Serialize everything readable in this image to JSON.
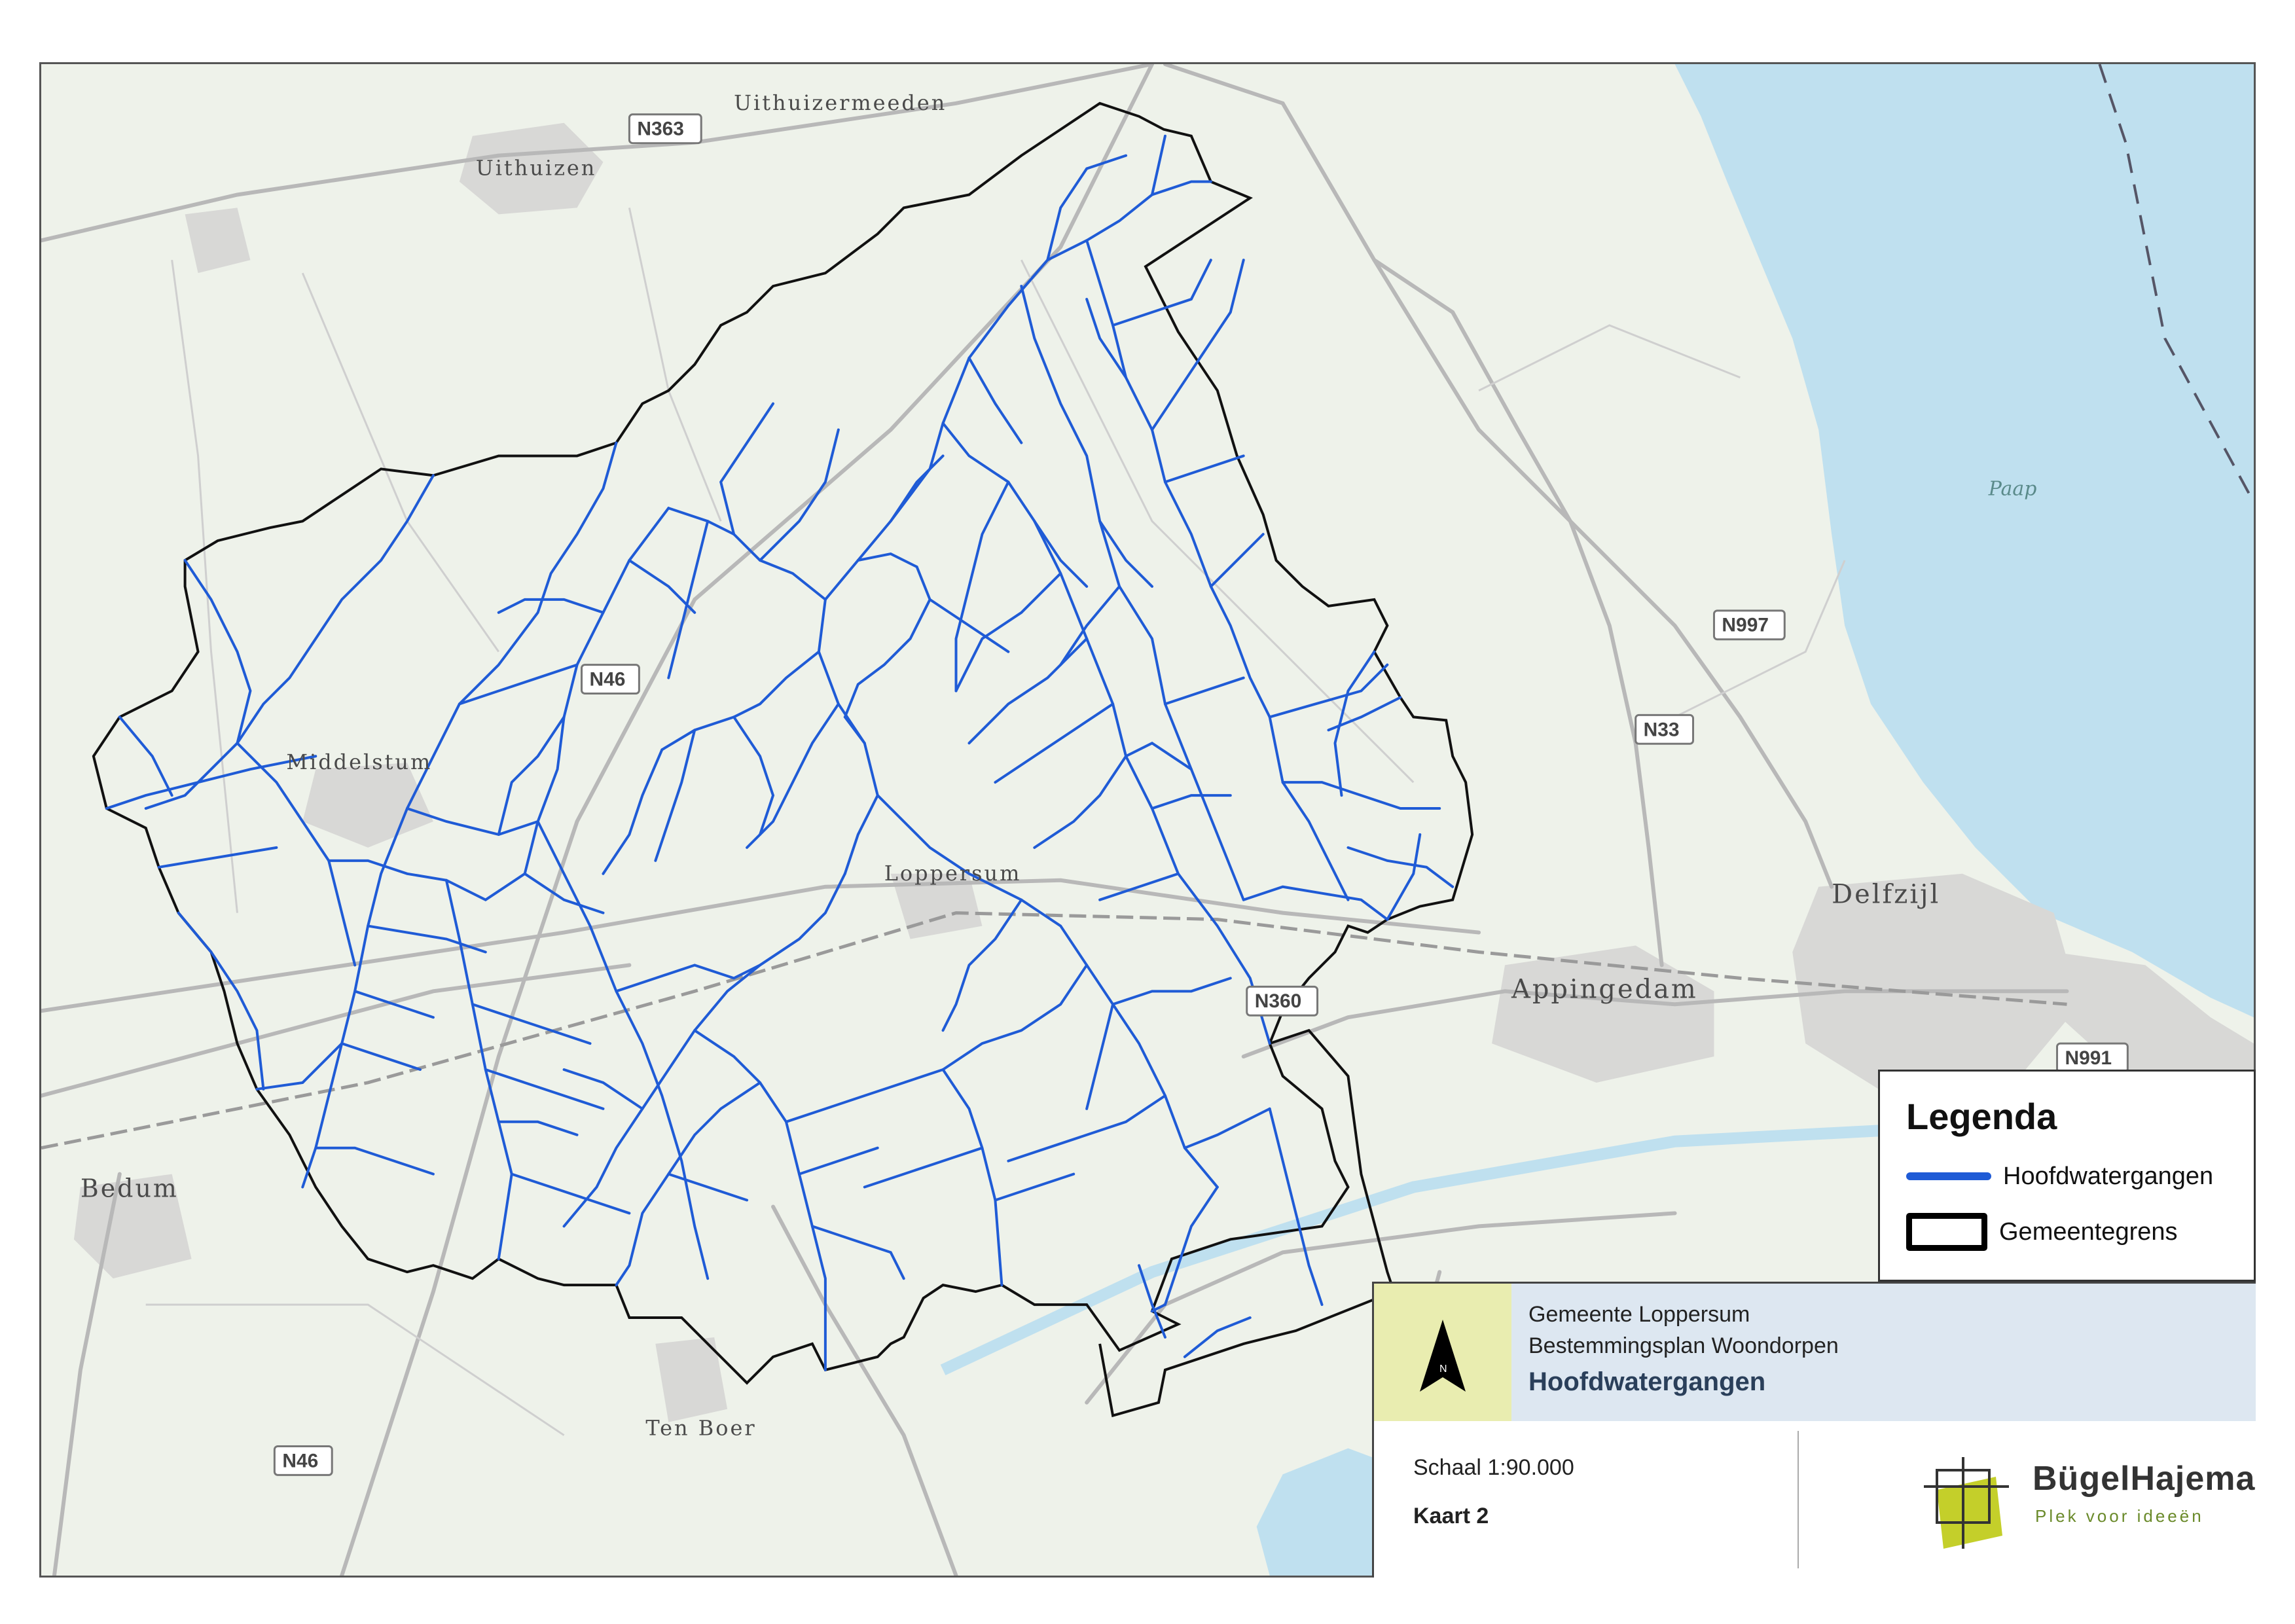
{
  "map": {
    "places": [
      {
        "name": "Uithuizermeeden"
      },
      {
        "name": "Uithuizen"
      },
      {
        "name": "Middelstum"
      },
      {
        "name": "Loppersum"
      },
      {
        "name": "Appingedam"
      },
      {
        "name": "Delfzijl"
      },
      {
        "name": "Bedum"
      },
      {
        "name": "Ten Boer"
      }
    ],
    "routes": [
      "N363",
      "N46",
      "N997",
      "N33",
      "N360",
      "N991",
      "N46"
    ],
    "water_labels": [
      "Paap"
    ],
    "colors": {
      "watergang": "#1f5bd6",
      "gemeentegrens": "#000000",
      "water": "#bfe0ef",
      "road": "#b8b8b8",
      "land": "#eef2ea"
    }
  },
  "legend": {
    "title": "Legenda",
    "items": [
      {
        "label": "Hoofdwatergangen",
        "symbol": "blue-line"
      },
      {
        "label": "Gemeentegrens",
        "symbol": "black-outline-box"
      }
    ]
  },
  "titleblock": {
    "line1": "Gemeente Loppersum",
    "line2": "Bestemmingsplan Woondorpen",
    "heading": "Hoofdwatergangen",
    "scale": "Schaal 1:90.000",
    "sheet": "Kaart 2",
    "north_label": "N"
  },
  "logo": {
    "name": "BügelHajema",
    "tagline": "Plek voor ideeën",
    "color": "#c4cf2a"
  }
}
